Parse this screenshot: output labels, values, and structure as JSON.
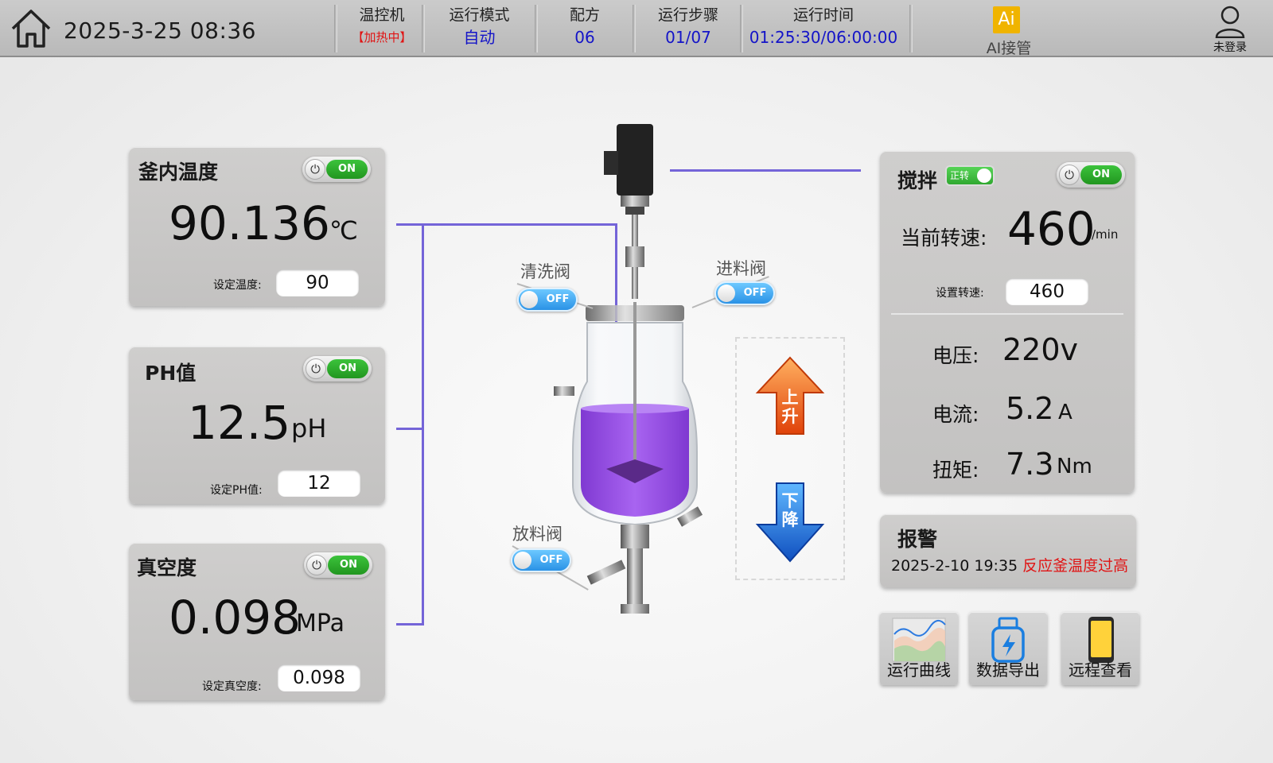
{
  "header": {
    "datetime": "2025-3-25 08:36",
    "temp_controller": {
      "label": "温控机",
      "status": "【加热中】",
      "status_color": "#e01414"
    },
    "run_mode": {
      "label": "运行模式",
      "value": "自动"
    },
    "recipe": {
      "label": "配方",
      "value": "06"
    },
    "run_step": {
      "label": "运行步骤",
      "value": "01/07"
    },
    "run_time": {
      "label": "运行时间",
      "value": "01:25:30/06:00:00"
    },
    "ai": {
      "icon_text": "Ai",
      "label": "AI接管"
    },
    "user": {
      "label": "未登录"
    }
  },
  "temperature": {
    "title": "釜内温度",
    "toggle": "ON",
    "value": "90.136",
    "unit": "℃",
    "set_label": "设定温度:",
    "set_value": "90"
  },
  "ph": {
    "title": "PH值",
    "toggle": "ON",
    "value": "12.5",
    "unit": "pH",
    "set_label": "设定PH值:",
    "set_value": "12"
  },
  "vacuum": {
    "title": "真空度",
    "toggle": "ON",
    "value": "0.098",
    "unit": "MPa",
    "set_label": "设定真空度:",
    "set_value": "0.098"
  },
  "valves": {
    "clean": {
      "label": "清洗阀",
      "state": "OFF"
    },
    "feed": {
      "label": "进料阀",
      "state": "OFF"
    },
    "discharge": {
      "label": "放料阀",
      "state": "OFF"
    }
  },
  "lift": {
    "up": "上升",
    "down": "下降"
  },
  "stirring": {
    "title": "搅拌",
    "direction": "正转",
    "toggle": "ON",
    "speed_label": "当前转速:",
    "speed_value": "460",
    "speed_unit": "/min",
    "set_label": "设置转速:",
    "set_value": "460",
    "voltage_label": "电压:",
    "voltage_value": "220v",
    "current_label": "电流:",
    "current_value": "5.2",
    "current_unit": "A",
    "torque_label": "扭矩:",
    "torque_value": "7.3",
    "torque_unit": "Nm"
  },
  "alarm": {
    "title": "报警",
    "time": "2025-2-10 19:35",
    "message": "反应釜温度过高",
    "message_color": "#e01414"
  },
  "functions": {
    "curve": "运行曲线",
    "export": "数据导出",
    "remote": "远程查看"
  },
  "colors": {
    "accent_value": "#1414c8",
    "toggle_on": "#2aa82a",
    "toggle_off": "#2a92e6",
    "connector": "#7464d8",
    "liquid": "#9a4ee8"
  },
  "icons": {
    "home": "home-icon",
    "user": "user-icon",
    "power": "power-icon",
    "up": "arrow-up-icon",
    "down": "arrow-down-icon",
    "curve": "line-chart-icon",
    "export": "usb-drive-icon",
    "remote": "phone-icon"
  }
}
